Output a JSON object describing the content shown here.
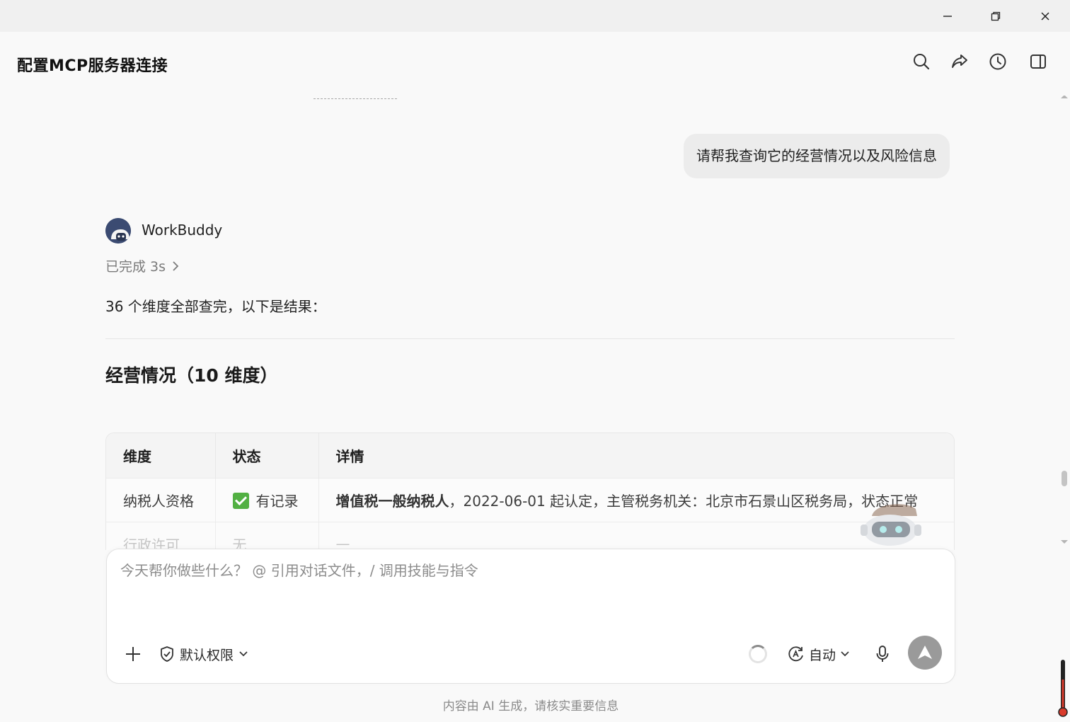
{
  "window": {
    "minimize_icon": "minimize-icon",
    "maximize_icon": "restore-icon",
    "close_icon": "close-icon"
  },
  "header": {
    "title": "配置MCP服务器连接",
    "actions": [
      "search-icon",
      "share-icon",
      "history-icon",
      "sidebar-toggle-icon"
    ]
  },
  "conversation": {
    "user_message": "请帮我查询它的经营情况以及风险信息",
    "assistant": {
      "name": "WorkBuddy",
      "status": "已完成 3s",
      "intro": "36 个维度全部查完，以下是结果：",
      "section_title": "经营情况（10 维度）",
      "table": {
        "headers": [
          "维度",
          "状态",
          "详情"
        ],
        "rows": [
          {
            "dimension": "纳税人资格",
            "status": "有记录",
            "status_icon": "green-check-icon",
            "detail_bold": "增值税一般纳税人",
            "detail_rest": "，2022-06-01 起认定，主管税务机关：北京市石景山区税务局，状态正常"
          },
          {
            "dimension": "行政许可",
            "status": "无",
            "detail_rest": "—"
          }
        ]
      }
    }
  },
  "composer": {
    "placeholder": "今天帮你做些什么？ @ 引用对话文件，/ 调用技能与指令",
    "value": "",
    "permission_label": "默认权限",
    "model_label": "自动"
  },
  "footer": {
    "note": "内容由 AI 生成，请核实重要信息"
  },
  "colors": {
    "background": "#f9f9f9",
    "user_bubble": "#ececec",
    "check_green": "#52b043",
    "send_button": "#9a9a9a"
  }
}
